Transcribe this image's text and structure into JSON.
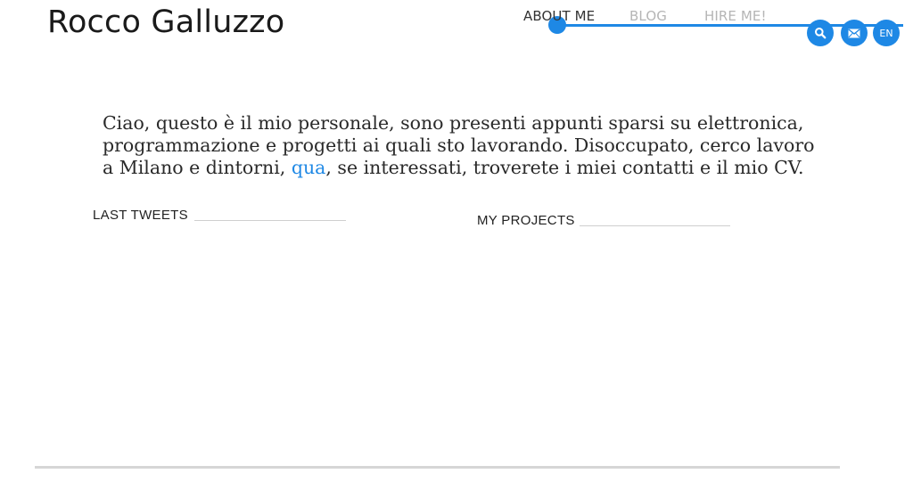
{
  "header": {
    "site_title": "Rocco Galluzzo"
  },
  "nav": {
    "items": [
      {
        "label": "ABOUT ME",
        "active": true
      },
      {
        "label": "BLOG",
        "active": false
      },
      {
        "label": "HIRE ME!",
        "active": false
      }
    ],
    "accent_color": "#1e88e5"
  },
  "actions": {
    "search_icon": "search-icon",
    "mail_icon": "mail-icon",
    "language_label": "EN"
  },
  "intro": {
    "text_before_link": "Ciao, questo è il mio personale, sono presenti appunti sparsi su elettronica, programmazione e progetti ai quali sto lavorando. Disoccupato, cerco lavoro a Milano e dintorni, ",
    "link_text": "qua",
    "text_after_link": ", se interessati, troverete i miei contatti e il mio CV."
  },
  "sections": {
    "tweets_heading": "LAST TWEETS",
    "projects_heading": "MY PROJECTS"
  }
}
